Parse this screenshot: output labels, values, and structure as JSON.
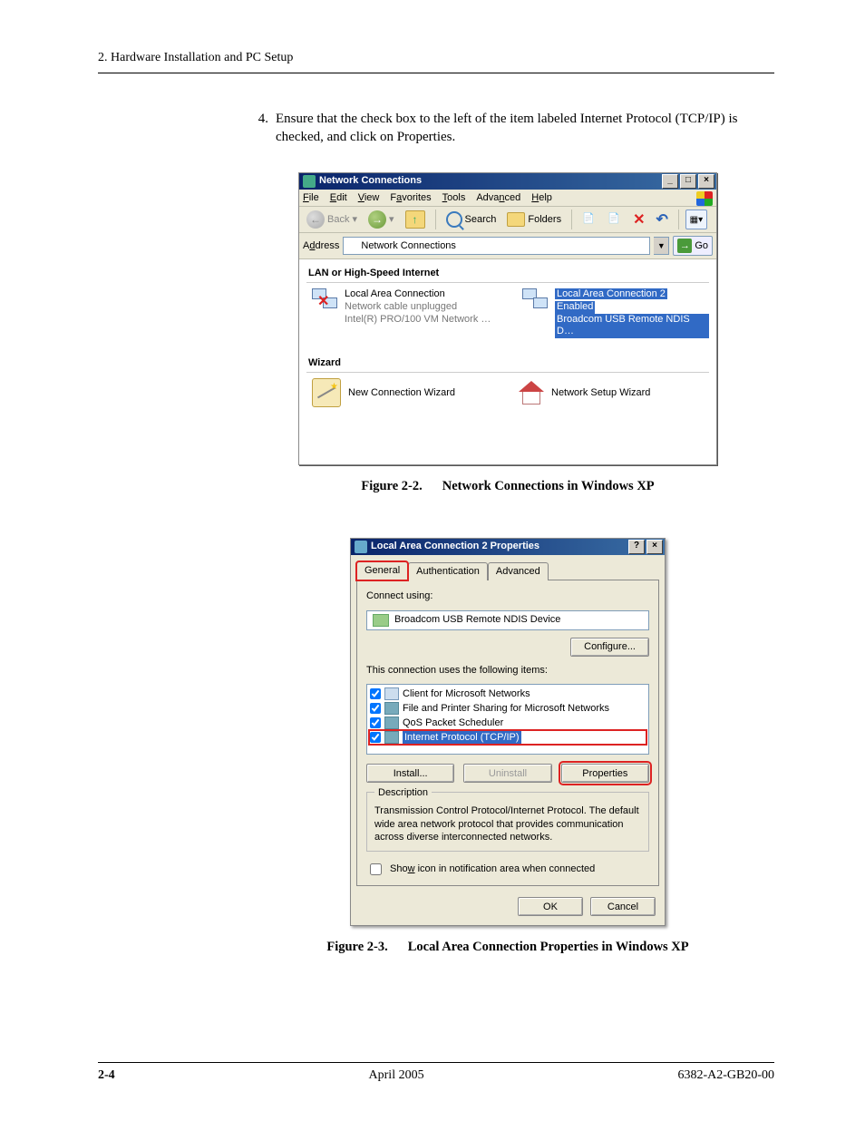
{
  "page": {
    "header": "2. Hardware Installation and PC Setup",
    "footer_left": "2-4",
    "footer_center": "April 2005",
    "footer_right": "6382-A2-GB20-00"
  },
  "step": {
    "number": "4.",
    "text": "Ensure that the check box to the left of the item labeled Internet Protocol (TCP/IP) is checked, and click on Properties."
  },
  "captions": {
    "c1_num": "Figure 2-2.",
    "c1_txt": "Network Connections in Windows XP",
    "c2_num": "Figure 2-3.",
    "c2_txt": "Local Area Connection Properties in Windows XP"
  },
  "fig1": {
    "title": "Network Connections",
    "menu": {
      "file": "File",
      "edit": "Edit",
      "view": "View",
      "fav": "Favorites",
      "tools": "Tools",
      "adv": "Advanced",
      "help": "Help"
    },
    "toolbar": {
      "back": "Back",
      "search": "Search",
      "folders": "Folders",
      "go": "Go"
    },
    "address_label": "Address",
    "address_value": "Network Connections",
    "group1": "LAN or High-Speed Internet",
    "conn1": {
      "l1": "Local Area Connection",
      "l2": "Network cable unplugged",
      "l3": "Intel(R) PRO/100 VM Network …"
    },
    "conn2": {
      "l1": "Local Area Connection 2",
      "l2": "Enabled",
      "l3": "Broadcom USB Remote NDIS D…"
    },
    "group2": "Wizard",
    "wiz1": "New Connection Wizard",
    "wiz2": "Network Setup Wizard"
  },
  "fig2": {
    "title": "Local Area Connection 2 Properties",
    "tabs": {
      "general": "General",
      "auth": "Authentication",
      "adv": "Advanced"
    },
    "connect_using": "Connect using:",
    "adapter": "Broadcom USB Remote NDIS Device",
    "configure": "Configure...",
    "items_label": "This connection uses the following items:",
    "items": {
      "i1": "Client for Microsoft Networks",
      "i2": "File and Printer Sharing for Microsoft Networks",
      "i3": "QoS Packet Scheduler",
      "i4": "Internet Protocol (TCP/IP)"
    },
    "install": "Install...",
    "uninstall": "Uninstall",
    "properties": "Properties",
    "desc_label": "Description",
    "desc_text": "Transmission Control Protocol/Internet Protocol. The default wide area network protocol that provides communication across diverse interconnected networks.",
    "show_icon": "Show icon in notification area when connected",
    "ok": "OK",
    "cancel": "Cancel"
  }
}
